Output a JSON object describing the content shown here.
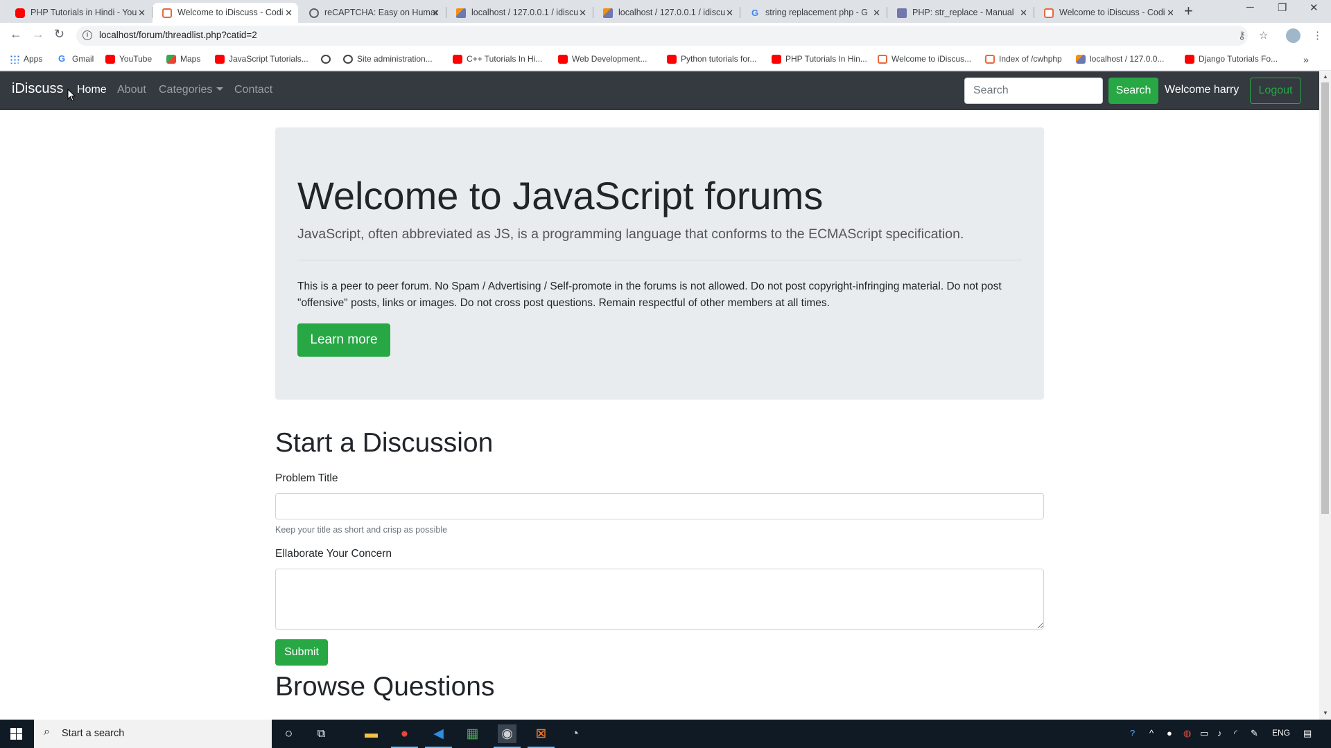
{
  "browser": {
    "tabs": [
      {
        "title": "PHP Tutorials in Hindi - You",
        "favicon": "youtube-icon"
      },
      {
        "title": "Welcome to iDiscuss - Codi",
        "favicon": "code-icon",
        "active": true
      },
      {
        "title": "reCAPTCHA: Easy on Humar",
        "favicon": "globe-icon"
      },
      {
        "title": "localhost / 127.0.0.1 / idiscu",
        "favicon": "phpmyadmin-icon"
      },
      {
        "title": "localhost / 127.0.0.1 / idiscu",
        "favicon": "phpmyadmin-icon"
      },
      {
        "title": "string replacement php - G",
        "favicon": "google-icon"
      },
      {
        "title": "PHP: str_replace - Manual",
        "favicon": "php-icon"
      },
      {
        "title": "Welcome to iDiscuss - Codi",
        "favicon": "code-icon"
      }
    ],
    "url": "localhost/forum/threadlist.php?catid=2",
    "bookmarks": [
      {
        "label": "Apps",
        "icon": "apps-icon"
      },
      {
        "label": "Gmail",
        "icon": "google-icon"
      },
      {
        "label": "YouTube",
        "icon": "youtube-icon"
      },
      {
        "label": "Maps",
        "icon": "maps-icon"
      },
      {
        "label": "JavaScript Tutorials...",
        "icon": "youtube-icon"
      },
      {
        "label": "",
        "icon": "globe-icon"
      },
      {
        "label": "Site administration...",
        "icon": "globe-icon"
      },
      {
        "label": "C++ Tutorials In Hi...",
        "icon": "youtube-icon"
      },
      {
        "label": "Web Development...",
        "icon": "youtube-icon"
      },
      {
        "label": "Python tutorials for...",
        "icon": "youtube-icon"
      },
      {
        "label": "PHP Tutorials In Hin...",
        "icon": "youtube-icon"
      },
      {
        "label": "Welcome to iDiscus...",
        "icon": "code-icon"
      },
      {
        "label": "Index of /cwhphp",
        "icon": "code-icon"
      },
      {
        "label": "localhost / 127.0.0...",
        "icon": "phpmyadmin-icon"
      },
      {
        "label": "Django Tutorials Fo...",
        "icon": "youtube-icon"
      }
    ]
  },
  "navbar": {
    "brand": "iDiscuss",
    "links": [
      "Home",
      "About",
      "Categories",
      "Contact"
    ],
    "search_placeholder": "Search",
    "search_button": "Search",
    "welcome": "Welcome harry",
    "logout": "Logout"
  },
  "jumbotron": {
    "title": "Welcome to JavaScript forums",
    "lead": "JavaScript, often abbreviated as JS, is a programming language that conforms to the ECMAScript specification.",
    "rules": "This is a peer to peer forum. No Spam / Advertising / Self-promote in the forums is not allowed. Do not post copyright-infringing material. Do not post \"offensive\" posts, links or images. Do not cross post questions. Remain respectful of other members at all times.",
    "button": "Learn more"
  },
  "form": {
    "heading": "Start a Discussion",
    "title_label": "Problem Title",
    "title_value": "",
    "title_help": "Keep your title as short and crisp as possible",
    "desc_label": "Ellaborate Your Concern",
    "desc_value": "",
    "submit": "Submit"
  },
  "browse_heading": "Browse Questions",
  "taskbar": {
    "search_placeholder": "Start a search",
    "language": "ENG"
  },
  "colors": {
    "navbar_bg": "#343a40",
    "success": "#28a745",
    "jumbotron_bg": "#e9ecef"
  }
}
